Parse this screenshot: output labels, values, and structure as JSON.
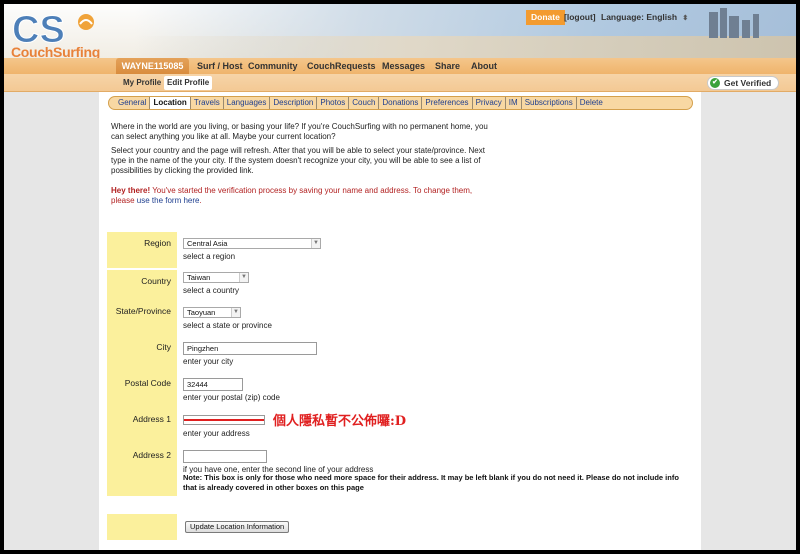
{
  "header": {
    "logo_text": "CouchSurfing",
    "donate_label": "Donate",
    "logout_label": "[logout]",
    "language_label": "Language: English",
    "language_caret": "⬍"
  },
  "nav": {
    "user": "WAYNE115085",
    "items": [
      "Surf / Host",
      "Community",
      "CouchRequests",
      "Messages",
      "Share",
      "About"
    ]
  },
  "subnav": {
    "items": [
      "My Profile",
      "Edit Profile"
    ],
    "active_index": 1,
    "verified_label": "Get Verified"
  },
  "tabs": {
    "items": [
      "General",
      "Location",
      "Travels",
      "Languages",
      "Description",
      "Photos",
      "Couch",
      "Donations",
      "Preferences",
      "Privacy",
      "IM",
      "Subscriptions",
      "Delete"
    ],
    "active_index": 1
  },
  "intro": {
    "p1": "Where in the world are you living, or basing your life? If you're CouchSurfing with no permanent home, you can select anything you like at all. Maybe your current location?",
    "p2": "Select your country and the page will refresh. After that you will be able to select your state/province. Next type in the name of the your city. If the system doesn't recognize your city, you will be able to see a list of possibilities by clicking the provided link."
  },
  "warning": {
    "bold": "Hey there!",
    "text": " You've started the verification process by saving your name and address. To change them, please ",
    "link": "use the form here",
    "end": "."
  },
  "form": {
    "region": {
      "label": "Region",
      "value": "Central Asia",
      "hint": "select a region"
    },
    "country": {
      "label": "Country",
      "value": "Taiwan",
      "hint": "select a country"
    },
    "state": {
      "label": "State/Province",
      "value": "Taoyuan",
      "hint": "select a state or province"
    },
    "city": {
      "label": "City",
      "value": "Pingzhen",
      "hint": "enter your city"
    },
    "postal": {
      "label": "Postal Code",
      "value": "32444",
      "hint": "enter your postal (zip) code"
    },
    "address1": {
      "label": "Address 1",
      "hint": "enter your address",
      "annotation": "個人隱私暫不公佈囉:D"
    },
    "address2": {
      "label": "Address 2",
      "value": "",
      "hint": "if you have one, enter the second line of your address",
      "note": "Note: This box is only for those who need more space for their address. It may be left blank if you do not need it. Please do not include info that is already covered in other boxes on this page"
    },
    "submit_label": "Update Location Information"
  },
  "colors": {
    "accent_orange": "#f39b2f",
    "label_yellow": "#fbf09c",
    "tab_bar": "#f8d8a3",
    "warning_red": "#b22222",
    "annotation_red": "#e02020"
  }
}
